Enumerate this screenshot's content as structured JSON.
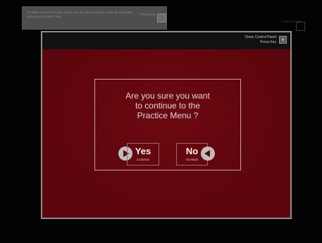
{
  "background": {
    "banner_text": "To select an item from the menu, use the cursor keys to move up and down and press the select key.",
    "banner_hint": "Press Key",
    "control_panel": "Control Panel"
  },
  "modal": {
    "close_line1": "Close Control Panel",
    "close_line2": "Press Key",
    "close_symbol": "×",
    "question_line1": "Are you sure you want",
    "question_line2": "to continue to the",
    "question_line3": "Practice Menu ?",
    "yes_label": "Yes",
    "yes_sub": "Continue",
    "no_label": "No",
    "no_sub": "Go Back"
  },
  "colors": {
    "modal_bg": "#5d050c",
    "title_bar": "#111111",
    "page_bg": "#030303"
  }
}
